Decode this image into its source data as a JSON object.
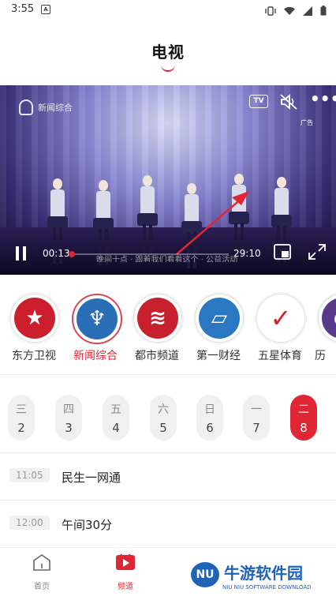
{
  "status_bar": {
    "time": "3:55",
    "notification_badge": "A"
  },
  "header": {
    "title": "电视"
  },
  "player": {
    "channel_logo_text": "新闻综合",
    "tv_label": "TV",
    "ad_label": "广告",
    "subtitle": "晚间十点 · 跟着我们看看这个 · 公益活动",
    "current_time": "00:13",
    "total_time": "29:10",
    "progress": 0.0074
  },
  "channels": [
    {
      "name": "东方卫视",
      "color": "#cc1f2d",
      "glyph": "★",
      "active": false
    },
    {
      "name": "新闻综合",
      "color": "#2a6fb5",
      "glyph": "♆",
      "active": true
    },
    {
      "name": "都市频道",
      "color": "#c8202c",
      "glyph": "≋",
      "active": false
    },
    {
      "name": "第一财经",
      "color": "#2a78c2",
      "glyph": "▱",
      "active": false
    },
    {
      "name": "五星体育",
      "color": "#ffffff",
      "glyph": "✓",
      "active": false
    },
    {
      "name": "历",
      "color": "#5a3a8a",
      "glyph": "◐",
      "active": false
    }
  ],
  "dates": [
    {
      "dow": "三",
      "num": "2",
      "active": false
    },
    {
      "dow": "四",
      "num": "3",
      "active": false
    },
    {
      "dow": "五",
      "num": "4",
      "active": false
    },
    {
      "dow": "六",
      "num": "5",
      "active": false
    },
    {
      "dow": "日",
      "num": "6",
      "active": false
    },
    {
      "dow": "一",
      "num": "7",
      "active": false
    },
    {
      "dow": "二",
      "num": "8",
      "active": true
    }
  ],
  "programs": [
    {
      "time": "11:05",
      "title": "民生一网通"
    },
    {
      "time": "12:00",
      "title": "午间30分"
    }
  ],
  "bottom_nav": [
    {
      "label": "首页",
      "icon": "home-icon",
      "active": false
    },
    {
      "label": "频道",
      "icon": "channel-play-icon",
      "active": true
    }
  ],
  "watermark": {
    "title": "牛游软件园",
    "subtitle": "NIU NIU SOFTWARE DOWNLOAD"
  },
  "colors": {
    "accent": "#e02634",
    "watermark_blue": "#1e63b8"
  }
}
